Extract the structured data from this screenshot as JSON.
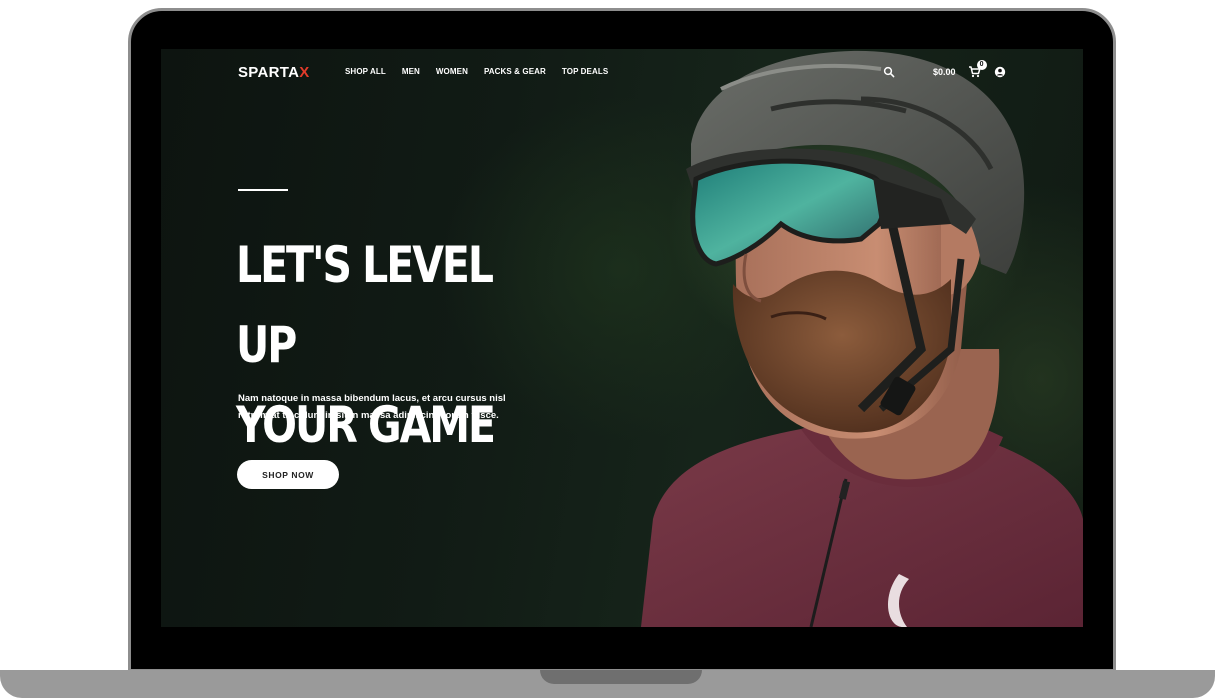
{
  "brand": {
    "name_main": "SPARTA",
    "name_accent": "X",
    "accent_color": "#e23b2a"
  },
  "nav": {
    "links": [
      "SHOP ALL",
      "MEN",
      "WOMEN",
      "PACKS & GEAR",
      "TOP DEALS"
    ],
    "icons": {
      "search": "search-icon",
      "cart": "cart-icon",
      "account": "user-icon"
    },
    "cart_amount": "$0.00",
    "cart_count": "0"
  },
  "hero": {
    "title_line1": "LET'S LEVEL UP",
    "title_line2": "YOUR GAME",
    "body_line1": "Nam natoque in massa bibendum lacus, et arcu cursus nisl",
    "body_line2": "rutrum at tincidunt in sit in massa adipiscing lorem fusce.",
    "cta_label": "SHOP NOW",
    "image": "cyclist-with-helmet-and-sunglasses"
  },
  "colors": {
    "background": "#0f1712",
    "text": "#ffffff",
    "button_bg": "#ffffff",
    "button_text": "#222222",
    "laptop_frame": "#000000",
    "laptop_base": "#9a9a9a"
  }
}
